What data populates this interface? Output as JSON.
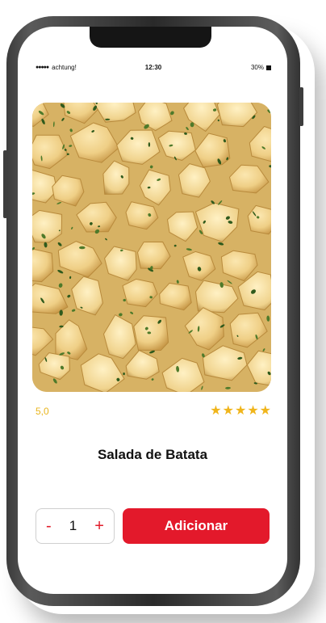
{
  "status_bar": {
    "signal": "●●●●●",
    "carrier": "achtung!",
    "time": "12:30",
    "battery": "30%"
  },
  "product": {
    "image_icon": "potato-salad-photo",
    "rating": "5,0",
    "rating_stars": 5,
    "star_glyph": "★",
    "title": "Salada de Batata"
  },
  "quantity": {
    "decrement": "-",
    "value": "1",
    "increment": "+"
  },
  "actions": {
    "add_label": "Adicionar"
  },
  "colors": {
    "accent": "#e3192b",
    "star": "#f0b51b",
    "rating_text": "#e9b51d"
  }
}
